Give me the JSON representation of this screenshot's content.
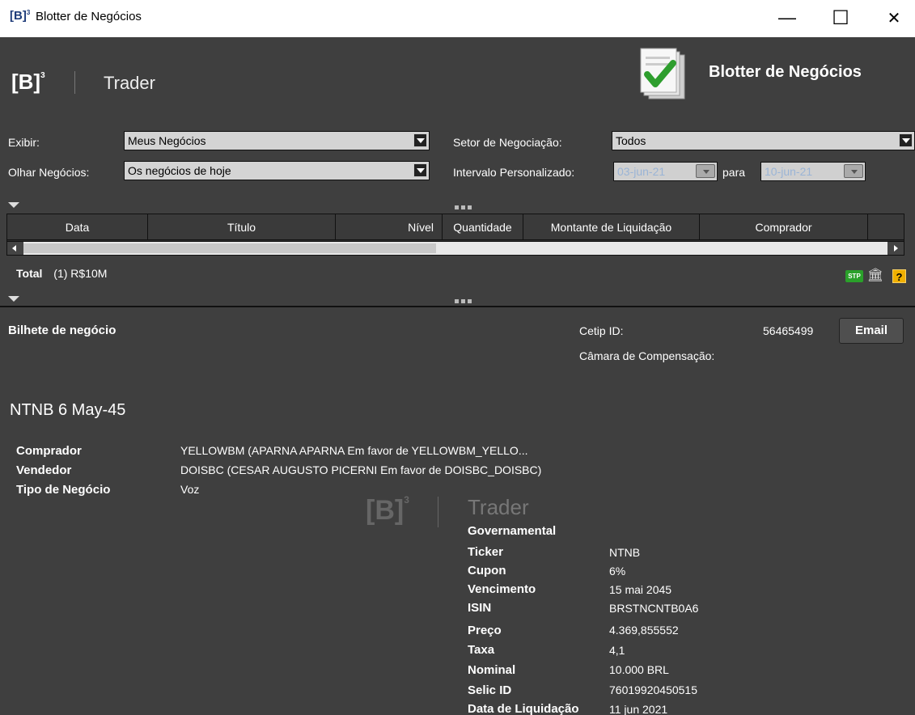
{
  "window": {
    "logo": "[B]",
    "logo_sup": "3",
    "title": "Blotter de Negócios",
    "minimize": "—",
    "maximize": "☐",
    "close": "✕"
  },
  "header": {
    "logo": "[B]",
    "logo_sup": "3",
    "product": "Trader",
    "app_title": "Blotter de Negócios"
  },
  "filters": {
    "exibir_label": "Exibir:",
    "exibir_value": "Meus Negócios",
    "olhar_label": "Olhar Negócios:",
    "olhar_value": "Os negócios de hoje",
    "setor_label": "Setor de Negociação:",
    "setor_value": "Todos",
    "intervalo_label": "Intervalo Personalizado:",
    "date_from": "03-jun-21",
    "para_label": "para",
    "date_to": "10-jun-21"
  },
  "grid": {
    "columns": [
      "Data",
      "Título",
      "Nível",
      "Quantidade",
      "Montante de Liquidação",
      "Comprador"
    ]
  },
  "summary": {
    "total_label": "Total",
    "total_value": "(1) R$10M",
    "stp_label": "STP",
    "help_label": "?"
  },
  "ticket": {
    "title": "Bilhete de negócio",
    "cetip_label": "Cetip ID:",
    "cetip_value": "56465499",
    "camara_label": "Câmara de Compensação:",
    "email_button": "Email",
    "instrument": "NTNB 6 May-45",
    "parties": [
      {
        "label": "Comprador",
        "value": "YELLOWBM (APARNA APARNA Em favor de YELLOWBM_YELLO..."
      },
      {
        "label": "Vendedor",
        "value": "DOISBC (CESAR AUGUSTO PICERNI Em favor de DOISBC_DOISBC)"
      },
      {
        "label": "Tipo de Negócio",
        "value": "Voz"
      }
    ],
    "watermark_logo": "[B]",
    "watermark_sup": "3",
    "watermark_product": "Trader",
    "section": "Governamental",
    "details": [
      {
        "label": "Ticker",
        "value": "NTNB"
      },
      {
        "label": "Cupon",
        "value": "6%"
      },
      {
        "label": "Vencimento",
        "value": "15 mai 2045"
      },
      {
        "label": "ISIN",
        "value": "BRSTNCNTB0A6"
      },
      {
        "label": "Preço",
        "value": "4.369,855552"
      },
      {
        "label": "Taxa",
        "value": "4,1"
      },
      {
        "label": "Nominal",
        "value": "10.000 BRL"
      },
      {
        "label": "Selic ID",
        "value": "76019920450515"
      },
      {
        "label": "Data de Liquidação",
        "value": "11 jun 2021"
      }
    ]
  },
  "colors": {
    "background": "#3f3f3f",
    "stp_green": "#2aa02a",
    "help_orange": "#f0b000",
    "check_green": "#2e9e2e"
  }
}
